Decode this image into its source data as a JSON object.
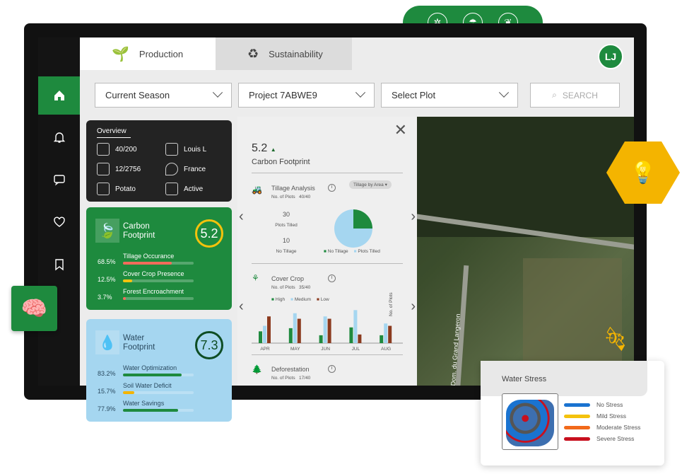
{
  "tabs": [
    {
      "label": "Production"
    },
    {
      "label": "Sustainability"
    }
  ],
  "user_initials": "LJ",
  "filters": {
    "season": "Current Season",
    "project": "Project 7ABWE9",
    "plot": "Select Plot",
    "search_placeholder": "SEARCH"
  },
  "overview": {
    "title": "Overview",
    "items": [
      {
        "icon": "field-icon",
        "value": "40/200"
      },
      {
        "icon": "farmer-icon",
        "value": "Louis L"
      },
      {
        "icon": "worker-icon",
        "value": "12/2756"
      },
      {
        "icon": "location-pin-icon",
        "value": "France"
      },
      {
        "icon": "crop-icon",
        "value": "Potato"
      },
      {
        "icon": "checklist-icon",
        "value": "Active"
      }
    ]
  },
  "carbon": {
    "title": "Carbon Footprint",
    "score": "5.2",
    "metrics": [
      {
        "pct": "68.5%",
        "label": "Tillage Occurance",
        "value": 68.5,
        "color": "#f26b5b"
      },
      {
        "pct": "12.5%",
        "label": "Cover Crop Presence",
        "value": 12.5,
        "color": "#f4c20d"
      },
      {
        "pct": "3.7%",
        "label": "Forest Encroachment",
        "value": 3.7,
        "color": "#f26b5b"
      }
    ]
  },
  "water": {
    "title": "Water Footprint",
    "score": "7.3",
    "metrics": [
      {
        "pct": "83.2%",
        "label": "Water Optimization",
        "value": 83.2,
        "color": "#1e8a3e"
      },
      {
        "pct": "15.7%",
        "label": "Soil Water Deficit",
        "value": 15.7,
        "color": "#f4b400"
      },
      {
        "pct": "77.9%",
        "label": "Water Savings",
        "value": 77.9,
        "color": "#1e8a3e"
      }
    ]
  },
  "detail": {
    "score": "5.2",
    "title": "Carbon Footprint",
    "tillage": {
      "title": "Tillage Analysis",
      "plots_label": "No. of Plots",
      "plots": "40/40",
      "dropdown": "Tillage by Area",
      "tilled_value": "30",
      "tilled_label": "Plots Tilled",
      "no_till_value": "10",
      "no_till_label": "No Tillage",
      "legend": [
        "No Tillage",
        "Plots Tilled"
      ]
    },
    "cover": {
      "title": "Cover Crop",
      "plots_label": "No. of Plots",
      "plots": "35/40",
      "legend": [
        "High",
        "Medium",
        "Low"
      ],
      "ylabel": "No. of Plots"
    },
    "deforestation": {
      "title": "Deforestation",
      "plots_label": "No. of Plots",
      "plots": "17/40"
    }
  },
  "chart_data": [
    {
      "type": "pie",
      "title": "Tillage Analysis",
      "categories": [
        "No Tillage",
        "Plots Tilled"
      ],
      "values": [
        10,
        30
      ],
      "colors": [
        "#1e8a3e",
        "#a5d6f0"
      ]
    },
    {
      "type": "bar",
      "title": "Cover Crop",
      "categories": [
        "APR",
        "MAY",
        "JUN",
        "JUL",
        "AUG"
      ],
      "ylabel": "No. of Plots",
      "series": [
        {
          "name": "High",
          "color": "#1e8a3e",
          "values": [
            15,
            19,
            10,
            20,
            10
          ]
        },
        {
          "name": "Medium",
          "color": "#a5d6f0",
          "values": [
            22,
            38,
            34,
            42,
            25
          ]
        },
        {
          "name": "Low",
          "color": "#8b3a1e",
          "values": [
            34,
            31,
            31,
            11,
            22
          ]
        }
      ]
    }
  ],
  "map": {
    "road_label": "Dom. du Grand Langeron"
  },
  "water_stress": {
    "title": "Water Stress",
    "legend": [
      {
        "label": "No Stress",
        "color": "#1a73d0"
      },
      {
        "label": "Mild Stress",
        "color": "#f4c20d"
      },
      {
        "label": "Moderate Stress",
        "color": "#f26a1b"
      },
      {
        "label": "Severe Stress",
        "color": "#c8101e"
      }
    ]
  }
}
